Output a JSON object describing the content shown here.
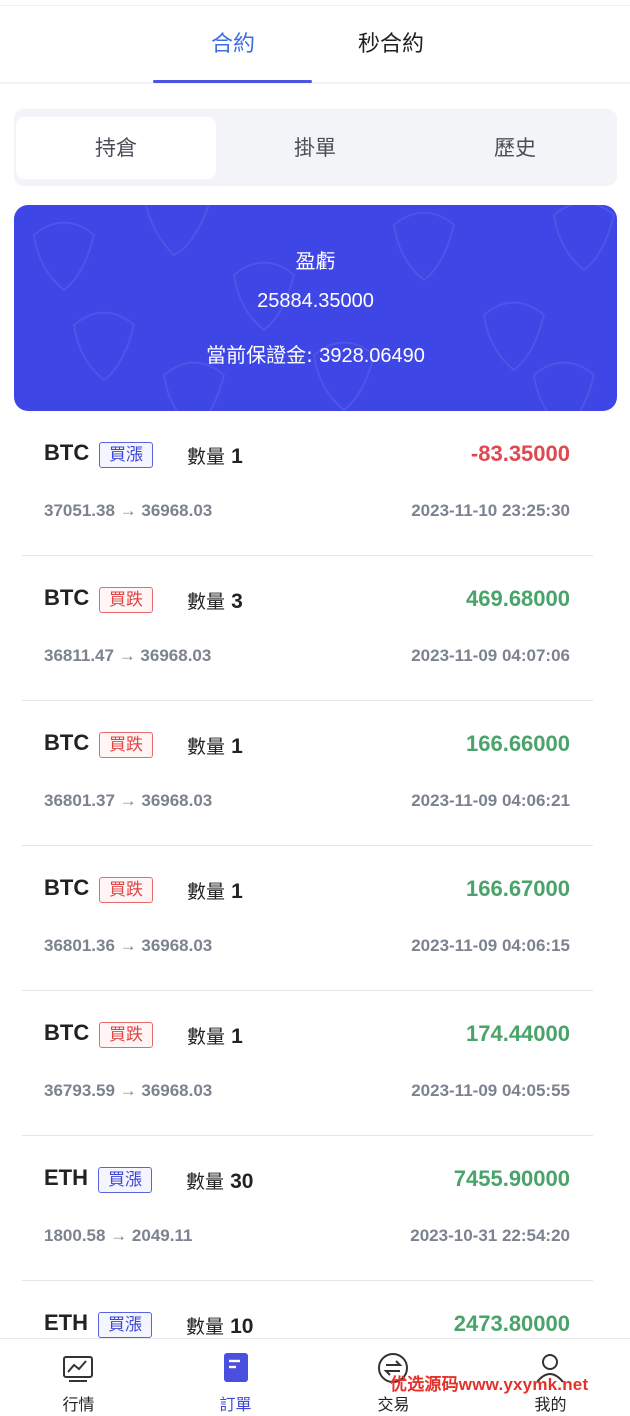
{
  "tabs": {
    "contract": "合約",
    "second_contract": "秒合約"
  },
  "segments": {
    "positions": "持倉",
    "pending": "掛單",
    "history": "歷史"
  },
  "summary": {
    "title": "盈虧",
    "value": "25884.35000",
    "margin_label": "當前保證金:",
    "margin_value": "3928.06490"
  },
  "qty_label": "數量",
  "orders": [
    {
      "symbol": "BTC",
      "side": "買漲",
      "side_type": "up",
      "qty": "1",
      "pnl": "-83.35000",
      "pnl_type": "neg",
      "open": "37051.38",
      "current": "36968.03",
      "time": "2023-11-10 23:25:30"
    },
    {
      "symbol": "BTC",
      "side": "買跌",
      "side_type": "down",
      "qty": "3",
      "pnl": "469.68000",
      "pnl_type": "pos",
      "open": "36811.47",
      "current": "36968.03",
      "time": "2023-11-09 04:07:06"
    },
    {
      "symbol": "BTC",
      "side": "買跌",
      "side_type": "down",
      "qty": "1",
      "pnl": "166.66000",
      "pnl_type": "pos",
      "open": "36801.37",
      "current": "36968.03",
      "time": "2023-11-09 04:06:21"
    },
    {
      "symbol": "BTC",
      "side": "買跌",
      "side_type": "down",
      "qty": "1",
      "pnl": "166.67000",
      "pnl_type": "pos",
      "open": "36801.36",
      "current": "36968.03",
      "time": "2023-11-09 04:06:15"
    },
    {
      "symbol": "BTC",
      "side": "買跌",
      "side_type": "down",
      "qty": "1",
      "pnl": "174.44000",
      "pnl_type": "pos",
      "open": "36793.59",
      "current": "36968.03",
      "time": "2023-11-09 04:05:55"
    },
    {
      "symbol": "ETH",
      "side": "買漲",
      "side_type": "up",
      "qty": "30",
      "pnl": "7455.90000",
      "pnl_type": "pos",
      "open": "1800.58",
      "current": "2049.11",
      "time": "2023-10-31 22:54:20"
    },
    {
      "symbol": "ETH",
      "side": "買漲",
      "side_type": "up",
      "qty": "10",
      "pnl": "2473.80000",
      "pnl_type": "pos",
      "open": "",
      "current": "",
      "time": ""
    }
  ],
  "nav": {
    "market": "行情",
    "orders": "訂單",
    "trade": "交易",
    "mine": "我的"
  },
  "nav_icons": {
    "market": "chart-icon",
    "orders": "document-icon",
    "trade": "exchange-icon",
    "mine": "user-icon"
  },
  "watermark": "优选源码www.yxymk.net",
  "colors": {
    "accent": "#3f46e6",
    "profit": "#4aa36a",
    "loss": "#e0474f",
    "tab_active": "#3d6de6"
  }
}
